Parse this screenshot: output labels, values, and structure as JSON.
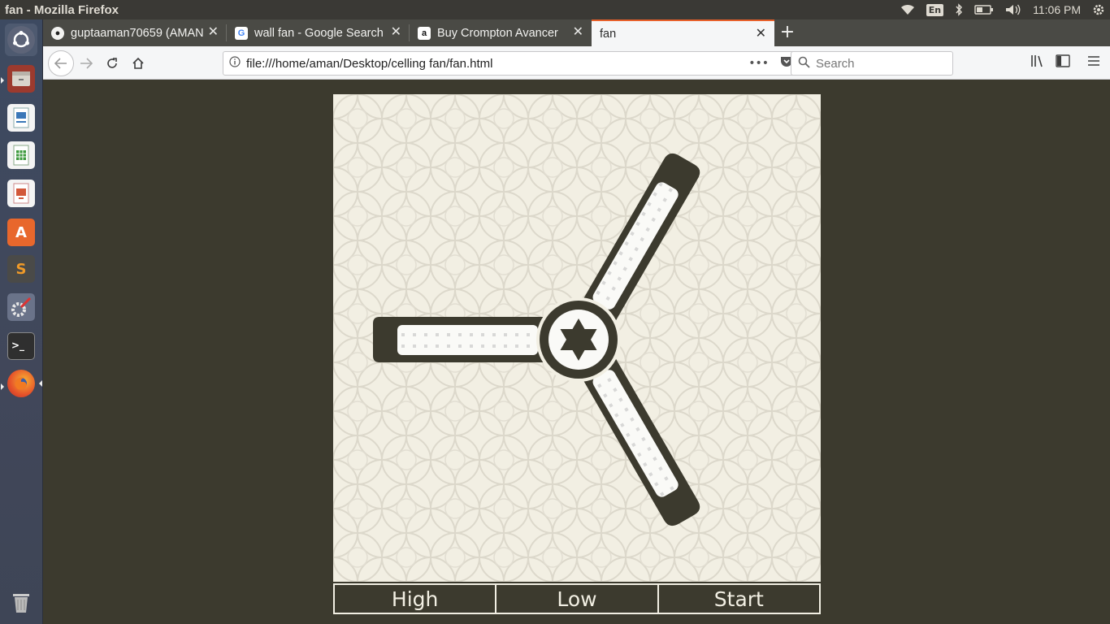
{
  "window": {
    "title": "fan - Mozilla Firefox"
  },
  "system_tray": {
    "keyboard": "En",
    "clock": "11:06 PM"
  },
  "tabs": [
    {
      "label": "guptaaman70659 (AMAN",
      "icon": "github-icon"
    },
    {
      "label": "wall fan - Google Search",
      "icon": "google-icon"
    },
    {
      "label": "Buy Crompton Avancer",
      "icon": "amazon-icon"
    },
    {
      "label": "fan",
      "icon": "none",
      "active": true
    }
  ],
  "navigation": {
    "url": "file:///home/aman/Desktop/celling fan/fan.html",
    "search_placeholder": "Search"
  },
  "page": {
    "buttons": {
      "high": "High",
      "low": "Low",
      "start": "Start"
    },
    "colors": {
      "background": "#3c3a2e",
      "panel": "#f2efe3",
      "blade": "#3c3a2e",
      "blade_inner": "#fafaf7"
    }
  }
}
